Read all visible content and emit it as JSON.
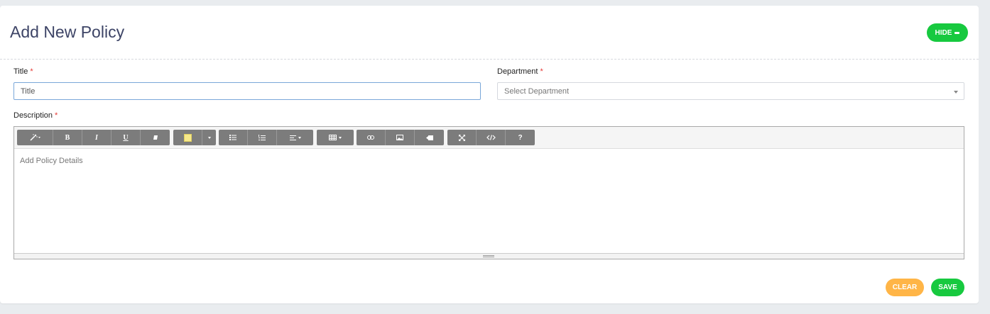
{
  "header": {
    "title": "Add New Policy",
    "hide_label": "HIDE"
  },
  "form": {
    "title_label": "Title",
    "title_required": "*",
    "title_placeholder": "Title",
    "department_label": "Department",
    "department_required": "*",
    "department_placeholder": "Select Department",
    "description_label": "Description",
    "description_required": "*",
    "description_placeholder": "Add Policy Details"
  },
  "toolbar": {
    "bold": "B",
    "italic": "I",
    "underline": "U",
    "help": "?",
    "highlight_color": "#f7e98a"
  },
  "actions": {
    "clear_label": "CLEAR",
    "save_label": "SAVE"
  },
  "colors": {
    "accent_green": "#17c93f",
    "accent_orange": "#ffb547",
    "title_color": "#3d4466"
  }
}
